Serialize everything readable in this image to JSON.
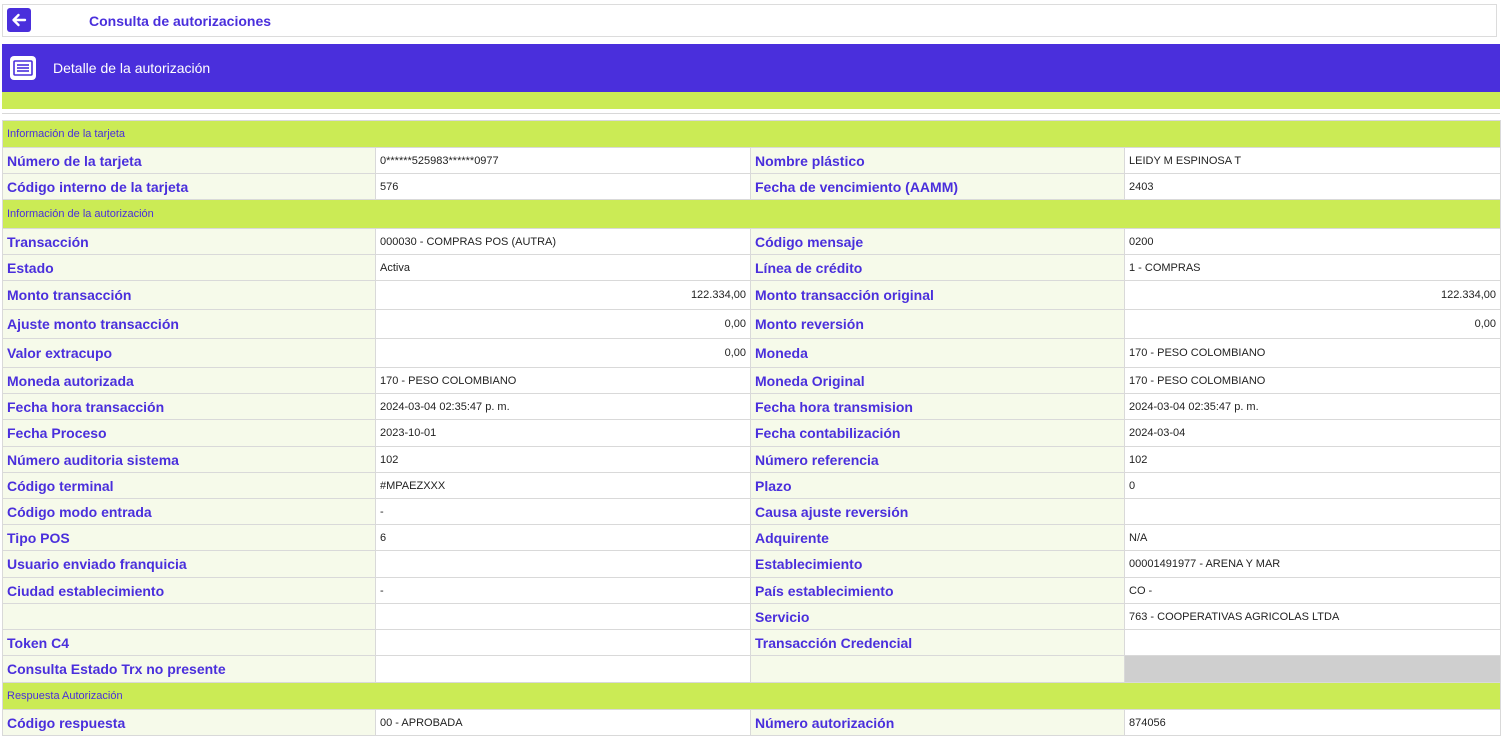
{
  "topbar": {
    "back_icon": "arrow-left-icon",
    "title": "Consulta de autorizaciones"
  },
  "header": {
    "icon": "document-list-icon",
    "title": "Detalle de la autorización"
  },
  "colors": {
    "primary": "#4a2fdc",
    "accent": "#cbeb55",
    "label_bg": "#f6faea",
    "disabled": "#cfcfcf"
  },
  "sections": {
    "card": {
      "title": "Información de la tarjeta",
      "rows": [
        [
          {
            "label": "Número de la tarjeta",
            "value": "0******525983******0977"
          },
          {
            "label": "Nombre plástico",
            "value": "LEIDY M ESPINOSA T"
          }
        ],
        [
          {
            "label": "Código interno de la tarjeta",
            "value": "576"
          },
          {
            "label": "Fecha de vencimiento (AAMM)",
            "value": "2403"
          }
        ]
      ]
    },
    "auth": {
      "title": "Información de la autorización",
      "rows": [
        [
          {
            "label": "Transacción",
            "value": "000030 - COMPRAS POS (AUTRA)"
          },
          {
            "label": "Código mensaje",
            "value": "0200"
          }
        ],
        [
          {
            "label": "Estado",
            "value": "Activa"
          },
          {
            "label": "Línea de crédito",
            "value": "1 - COMPRAS"
          }
        ],
        [
          {
            "label": "Monto transacción",
            "value": "122.334,00"
          },
          {
            "label": "Monto transacción original",
            "value": "122.334,00"
          }
        ],
        [
          {
            "label": "Ajuste monto transacción",
            "value": "0,00"
          },
          {
            "label": "Monto reversión",
            "value": "0,00"
          }
        ],
        [
          {
            "label": "Valor extracupo",
            "value": "0,00"
          },
          {
            "label": "Moneda",
            "value": "170 - PESO COLOMBIANO"
          }
        ],
        [
          {
            "label": "Moneda autorizada",
            "value": "170 - PESO COLOMBIANO"
          },
          {
            "label": "Moneda Original",
            "value": "170 - PESO COLOMBIANO"
          }
        ],
        [
          {
            "label": "Fecha hora transacción",
            "value": "2024-03-04 02:35:47 p. m."
          },
          {
            "label": "Fecha hora transmision",
            "value": "2024-03-04 02:35:47 p. m."
          }
        ],
        [
          {
            "label": "Fecha Proceso",
            "value": "2023-10-01"
          },
          {
            "label": "Fecha contabilización",
            "value": "2024-03-04"
          }
        ],
        [
          {
            "label": "Número auditoria sistema",
            "value": "102"
          },
          {
            "label": "Número referencia",
            "value": "102"
          }
        ],
        [
          {
            "label": "Código terminal",
            "value": "#MPAEZXXX"
          },
          {
            "label": "Plazo",
            "value": "0"
          }
        ],
        [
          {
            "label": "Código modo entrada",
            "value": "-"
          },
          {
            "label": "Causa ajuste reversión",
            "value": ""
          }
        ],
        [
          {
            "label": "Tipo POS",
            "value": "6"
          },
          {
            "label": "Adquirente",
            "value": "N/A"
          }
        ],
        [
          {
            "label": "Usuario enviado franquicia",
            "value": ""
          },
          {
            "label": "Establecimiento",
            "value": "00001491977 - ARENA Y MAR"
          }
        ],
        [
          {
            "label": "Ciudad establecimiento",
            "value": "-"
          },
          {
            "label": "País establecimiento",
            "value": "CO -"
          }
        ],
        [
          {
            "label": "",
            "value": ""
          },
          {
            "label": "Servicio",
            "value": "763 - COOPERATIVAS AGRICOLAS LTDA"
          }
        ],
        [
          {
            "label": "Token C4",
            "value": ""
          },
          {
            "label": "Transacción Credencial",
            "value": ""
          }
        ],
        [
          {
            "label": "Consulta Estado Trx no presente",
            "value": ""
          },
          {
            "label": "",
            "value": ""
          }
        ]
      ]
    },
    "response": {
      "title": "Respuesta Autorización",
      "rows": [
        [
          {
            "label": "Código respuesta",
            "value": "00 - APROBADA"
          },
          {
            "label": "Número autorización",
            "value": "874056"
          }
        ]
      ]
    }
  }
}
